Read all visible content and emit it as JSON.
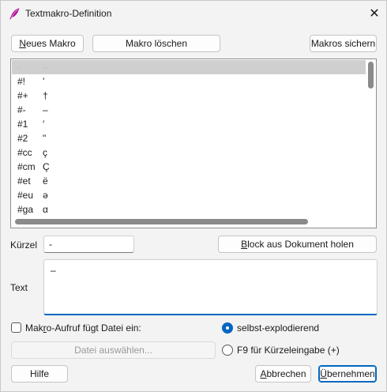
{
  "window": {
    "title": "Textmakro-Definition",
    "close_glyph": "✕",
    "accent_color": "#0067c0",
    "app_icon": "quill-feather-icon"
  },
  "toolbar": {
    "new_pre": "",
    "new_u": "N",
    "new_post": "eues Makro",
    "delete_label": "Makro löschen",
    "save_label": "Makros sichern"
  },
  "macro_list": {
    "items": [
      {
        "key": "-",
        "value": "–",
        "selected": true
      },
      {
        "key": "#!",
        "value": "'",
        "selected": false
      },
      {
        "key": "#+",
        "value": "†",
        "selected": false
      },
      {
        "key": "#-",
        "value": "–",
        "selected": false
      },
      {
        "key": "#1",
        "value": "′",
        "selected": false
      },
      {
        "key": "#2",
        "value": "\"",
        "selected": false
      },
      {
        "key": "#cc",
        "value": "ç",
        "selected": false
      },
      {
        "key": "#cm",
        "value": "Ç",
        "selected": false
      },
      {
        "key": "#et",
        "value": "ë",
        "selected": false
      },
      {
        "key": "#eu",
        "value": "ə",
        "selected": false
      },
      {
        "key": "#ga",
        "value": "α",
        "selected": false
      }
    ]
  },
  "form": {
    "shortcut_label": "Kürzel",
    "shortcut_value": "-",
    "block_pre": "",
    "block_u": "B",
    "block_post": "lock aus Dokument holen",
    "text_label": "Text",
    "text_value": "–",
    "include_pre": "Mak",
    "include_u": "r",
    "include_post": "o-Aufruf fügt Datei ein:",
    "include_checked": false,
    "file_button_label": "Datei auswählen...",
    "radio_self_label": "selbst-explodierend",
    "radio_self_checked": true,
    "radio_f9_label": "F9 für Kürzeleingabe (+)",
    "radio_f9_checked": false
  },
  "footer": {
    "help_label": "Hilfe",
    "cancel_pre": "",
    "cancel_u": "A",
    "cancel_post": "bbrechen",
    "ok_pre": "",
    "ok_u": "Ü",
    "ok_post": "bernehmen"
  }
}
